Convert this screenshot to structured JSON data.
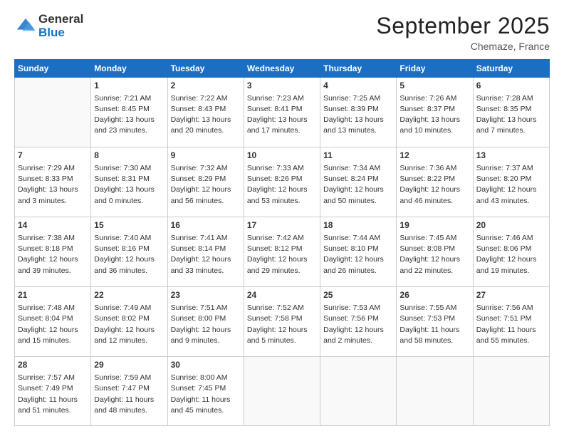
{
  "header": {
    "logo_general": "General",
    "logo_blue": "Blue",
    "month_title": "September 2025",
    "location": "Chemaze, France"
  },
  "days_of_week": [
    "Sunday",
    "Monday",
    "Tuesday",
    "Wednesday",
    "Thursday",
    "Friday",
    "Saturday"
  ],
  "weeks": [
    [
      {
        "day": "",
        "info": ""
      },
      {
        "day": "1",
        "info": "Sunrise: 7:21 AM\nSunset: 8:45 PM\nDaylight: 13 hours\nand 23 minutes."
      },
      {
        "day": "2",
        "info": "Sunrise: 7:22 AM\nSunset: 8:43 PM\nDaylight: 13 hours\nand 20 minutes."
      },
      {
        "day": "3",
        "info": "Sunrise: 7:23 AM\nSunset: 8:41 PM\nDaylight: 13 hours\nand 17 minutes."
      },
      {
        "day": "4",
        "info": "Sunrise: 7:25 AM\nSunset: 8:39 PM\nDaylight: 13 hours\nand 13 minutes."
      },
      {
        "day": "5",
        "info": "Sunrise: 7:26 AM\nSunset: 8:37 PM\nDaylight: 13 hours\nand 10 minutes."
      },
      {
        "day": "6",
        "info": "Sunrise: 7:28 AM\nSunset: 8:35 PM\nDaylight: 13 hours\nand 7 minutes."
      }
    ],
    [
      {
        "day": "7",
        "info": "Sunrise: 7:29 AM\nSunset: 8:33 PM\nDaylight: 13 hours\nand 3 minutes."
      },
      {
        "day": "8",
        "info": "Sunrise: 7:30 AM\nSunset: 8:31 PM\nDaylight: 13 hours\nand 0 minutes."
      },
      {
        "day": "9",
        "info": "Sunrise: 7:32 AM\nSunset: 8:29 PM\nDaylight: 12 hours\nand 56 minutes."
      },
      {
        "day": "10",
        "info": "Sunrise: 7:33 AM\nSunset: 8:26 PM\nDaylight: 12 hours\nand 53 minutes."
      },
      {
        "day": "11",
        "info": "Sunrise: 7:34 AM\nSunset: 8:24 PM\nDaylight: 12 hours\nand 50 minutes."
      },
      {
        "day": "12",
        "info": "Sunrise: 7:36 AM\nSunset: 8:22 PM\nDaylight: 12 hours\nand 46 minutes."
      },
      {
        "day": "13",
        "info": "Sunrise: 7:37 AM\nSunset: 8:20 PM\nDaylight: 12 hours\nand 43 minutes."
      }
    ],
    [
      {
        "day": "14",
        "info": "Sunrise: 7:38 AM\nSunset: 8:18 PM\nDaylight: 12 hours\nand 39 minutes."
      },
      {
        "day": "15",
        "info": "Sunrise: 7:40 AM\nSunset: 8:16 PM\nDaylight: 12 hours\nand 36 minutes."
      },
      {
        "day": "16",
        "info": "Sunrise: 7:41 AM\nSunset: 8:14 PM\nDaylight: 12 hours\nand 33 minutes."
      },
      {
        "day": "17",
        "info": "Sunrise: 7:42 AM\nSunset: 8:12 PM\nDaylight: 12 hours\nand 29 minutes."
      },
      {
        "day": "18",
        "info": "Sunrise: 7:44 AM\nSunset: 8:10 PM\nDaylight: 12 hours\nand 26 minutes."
      },
      {
        "day": "19",
        "info": "Sunrise: 7:45 AM\nSunset: 8:08 PM\nDaylight: 12 hours\nand 22 minutes."
      },
      {
        "day": "20",
        "info": "Sunrise: 7:46 AM\nSunset: 8:06 PM\nDaylight: 12 hours\nand 19 minutes."
      }
    ],
    [
      {
        "day": "21",
        "info": "Sunrise: 7:48 AM\nSunset: 8:04 PM\nDaylight: 12 hours\nand 15 minutes."
      },
      {
        "day": "22",
        "info": "Sunrise: 7:49 AM\nSunset: 8:02 PM\nDaylight: 12 hours\nand 12 minutes."
      },
      {
        "day": "23",
        "info": "Sunrise: 7:51 AM\nSunset: 8:00 PM\nDaylight: 12 hours\nand 9 minutes."
      },
      {
        "day": "24",
        "info": "Sunrise: 7:52 AM\nSunset: 7:58 PM\nDaylight: 12 hours\nand 5 minutes."
      },
      {
        "day": "25",
        "info": "Sunrise: 7:53 AM\nSunset: 7:56 PM\nDaylight: 12 hours\nand 2 minutes."
      },
      {
        "day": "26",
        "info": "Sunrise: 7:55 AM\nSunset: 7:53 PM\nDaylight: 11 hours\nand 58 minutes."
      },
      {
        "day": "27",
        "info": "Sunrise: 7:56 AM\nSunset: 7:51 PM\nDaylight: 11 hours\nand 55 minutes."
      }
    ],
    [
      {
        "day": "28",
        "info": "Sunrise: 7:57 AM\nSunset: 7:49 PM\nDaylight: 11 hours\nand 51 minutes."
      },
      {
        "day": "29",
        "info": "Sunrise: 7:59 AM\nSunset: 7:47 PM\nDaylight: 11 hours\nand 48 minutes."
      },
      {
        "day": "30",
        "info": "Sunrise: 8:00 AM\nSunset: 7:45 PM\nDaylight: 11 hours\nand 45 minutes."
      },
      {
        "day": "",
        "info": ""
      },
      {
        "day": "",
        "info": ""
      },
      {
        "day": "",
        "info": ""
      },
      {
        "day": "",
        "info": ""
      }
    ]
  ]
}
